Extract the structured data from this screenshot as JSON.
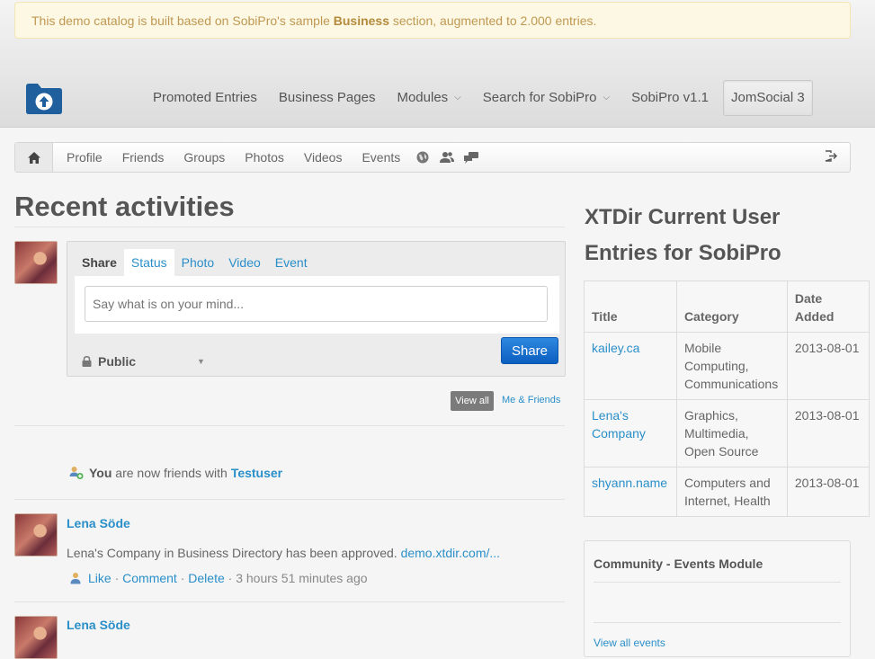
{
  "notice": {
    "prefix": "This demo catalog is built based on SobiPro's sample",
    "highlight": "Business",
    "suffix": "section, augmented to 2.000 entries."
  },
  "main_nav": [
    {
      "label": "Promoted Entries",
      "dropdown": false
    },
    {
      "label": "Business Pages",
      "dropdown": false
    },
    {
      "label": "Modules",
      "dropdown": true
    },
    {
      "label": "Search for SobiPro",
      "dropdown": true
    },
    {
      "label": "SobiPro v1.1",
      "dropdown": false
    },
    {
      "label": "JomSocial 3",
      "dropdown": false,
      "active": true
    }
  ],
  "toolbar": {
    "items": [
      "Profile",
      "Friends",
      "Groups",
      "Photos",
      "Videos",
      "Events"
    ]
  },
  "recent": {
    "title": "Recent activities"
  },
  "share": {
    "tabs": [
      "Share",
      "Status",
      "Photo",
      "Video",
      "Event"
    ],
    "placeholder": "Say what is on your mind...",
    "privacy": "Public",
    "button": "Share"
  },
  "filters": {
    "view_all": "View all",
    "me_friends": "Me & Friends"
  },
  "activities": {
    "friends": {
      "you": "You",
      "text": "are now friends with",
      "target": "Testuser"
    },
    "item1": {
      "name": "Lena Söde",
      "text": "Lena's Company in Business Directory has been approved.",
      "link": "demo.xtdir.com/...",
      "like": "Like",
      "comment": "Comment",
      "delete": "Delete",
      "time": "3 hours 51 minutes ago"
    },
    "item2": {
      "name": "Lena Söde"
    }
  },
  "xtdir": {
    "title": "XTDir Current User Entries for SobiPro",
    "headers": [
      "Title",
      "Category",
      "Date Added"
    ],
    "rows": [
      {
        "title": "kailey.ca",
        "category": "Mobile Computing, Communications",
        "date": "2013-08-01"
      },
      {
        "title": "Lena's Company",
        "category": "Graphics, Multimedia, Open Source",
        "date": "2013-08-01"
      },
      {
        "title": "shyann.name",
        "category": "Computers and Internet, Health",
        "date": "2013-08-01"
      }
    ]
  },
  "events_module": {
    "title": "Community - Events Module",
    "link": "View all events"
  },
  "colors": {
    "accent": "#2a8fc9",
    "share_button": "#0b5fbf",
    "notice_bg": "#fcf8e3"
  }
}
